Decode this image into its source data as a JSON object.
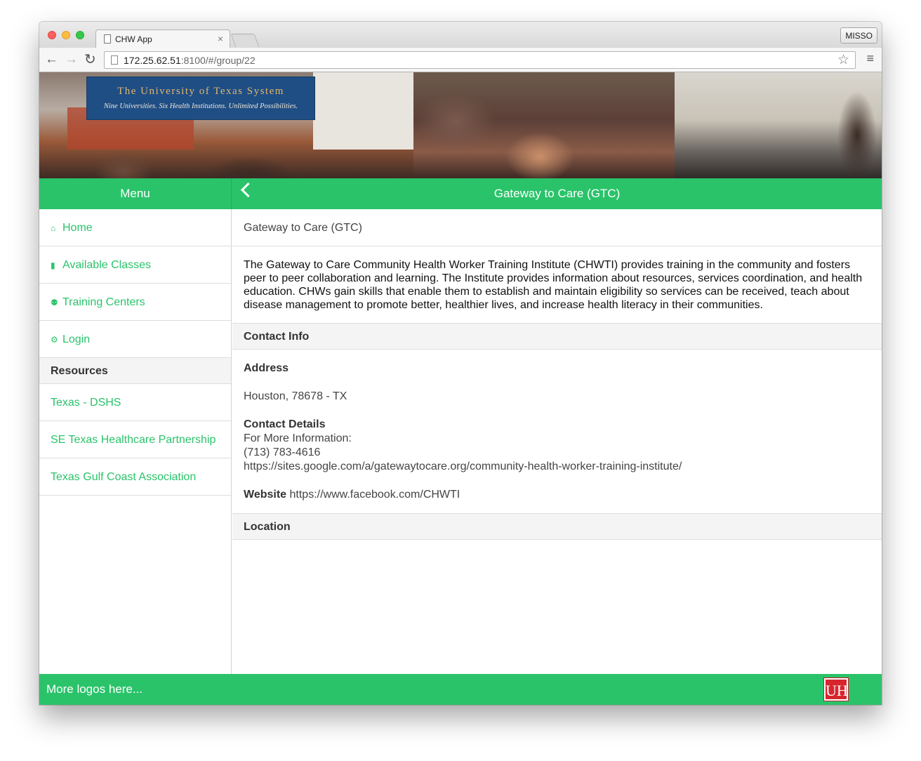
{
  "browser": {
    "tab_title": "CHW App",
    "tab_close": "×",
    "profile_button": "MISSO",
    "url_host": "172.25.62.51",
    "url_rest": ":8100/#/group/22",
    "back_glyph": "←",
    "forward_glyph": "→",
    "reload_glyph": "↻",
    "star_glyph": "☆",
    "menu_glyph": "≡"
  },
  "banner": {
    "logo_title": "The University of Texas System",
    "logo_subtitle": "Nine Universities. Six Health Institutions. Unlimited Possibilities."
  },
  "header": {
    "menu_title": "Menu",
    "page_title": "Gateway to Care (GTC)"
  },
  "sidebar": {
    "items": [
      {
        "label": "Home",
        "icon": "home-icon",
        "glyph": "⌂"
      },
      {
        "label": "Available Classes",
        "icon": "book-icon",
        "glyph": "▮"
      },
      {
        "label": "Training Centers",
        "icon": "people-icon",
        "glyph": "⚉"
      },
      {
        "label": "Login",
        "icon": "gear-icon",
        "glyph": "⚙"
      }
    ],
    "resources_heading": "Resources",
    "resources": [
      {
        "label": "Texas - DSHS"
      },
      {
        "label": "SE Texas Healthcare Partnership"
      },
      {
        "label": "Texas Gulf Coast Association"
      }
    ]
  },
  "main": {
    "title": "Gateway to Care (GTC)",
    "description": "The Gateway to Care Community Health Worker Training Institute (CHWTI) provides training in the community and fosters peer to peer collaboration and learning. The Institute provides information about resources, services coordination, and health education. CHWs gain skills that enable them to establish and maintain eligibility so services can be received, teach about disease management to promote better, healthier lives, and increase health literacy in their communities.",
    "contact_heading": "Contact Info",
    "address_label": "Address",
    "address_value": "Houston, 78678 - TX",
    "details_label": "Contact Details",
    "details_line1": "For More Information:",
    "details_phone": "(713) 783-4616",
    "details_url": "https://sites.google.com/a/gatewaytocare.org/community-health-worker-training-institute/",
    "website_label": "Website",
    "website_value": "https://www.facebook.com/CHWTI",
    "location_heading": "Location"
  },
  "footer": {
    "text": "More logos here...",
    "logo_letters": "UH"
  },
  "colors": {
    "brand_green": "#2ac36a",
    "ut_blue": "#1f4e85",
    "uh_red": "#d7252e"
  }
}
